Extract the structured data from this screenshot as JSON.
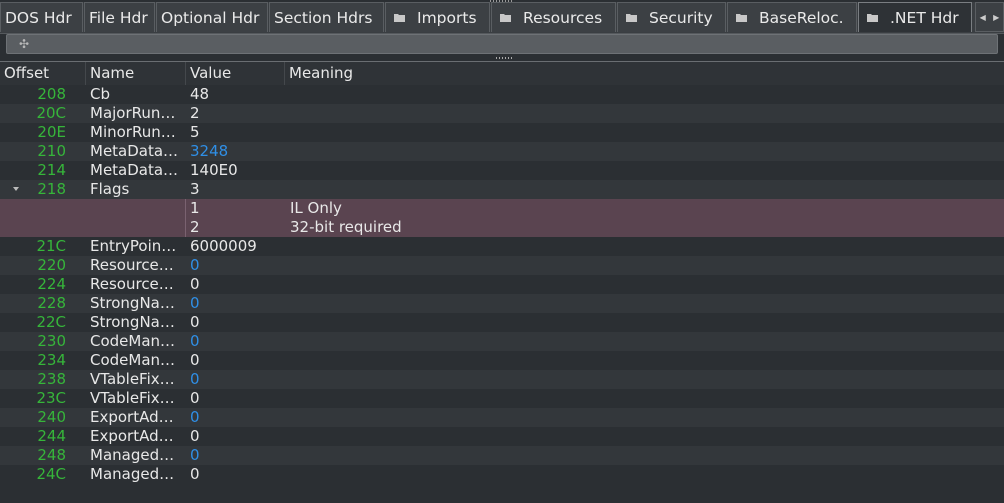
{
  "tabs": [
    {
      "label": "DOS Hdr",
      "folder": false
    },
    {
      "label": "File Hdr",
      "folder": false
    },
    {
      "label": "Optional Hdr",
      "folder": false
    },
    {
      "label": "Section Hdrs",
      "folder": false
    },
    {
      "label": "Imports",
      "folder": true
    },
    {
      "label": "Resources",
      "folder": true
    },
    {
      "label": "Security",
      "folder": true
    },
    {
      "label": "BaseReloc.",
      "folder": true
    },
    {
      "label": ".NET Hdr",
      "folder": true,
      "active": true
    }
  ],
  "columns": {
    "offset": "Offset",
    "name": "Name",
    "value": "Value",
    "meaning": "Meaning"
  },
  "rows": [
    {
      "offset": "208",
      "name": "Cb",
      "value": "48",
      "link": false
    },
    {
      "offset": "20C",
      "name": "MajorRun…",
      "value": "2",
      "link": false
    },
    {
      "offset": "20E",
      "name": "MinorRun…",
      "value": "5",
      "link": false
    },
    {
      "offset": "210",
      "name": "MetaData…",
      "value": "3248",
      "link": true
    },
    {
      "offset": "214",
      "name": "MetaData…",
      "value": "140E0",
      "link": false
    },
    {
      "offset": "218",
      "name": "Flags",
      "value": "3",
      "link": false,
      "expanded": true
    },
    {
      "sub": true,
      "value": "1",
      "meaning": "IL Only"
    },
    {
      "sub": true,
      "value": "2",
      "meaning": "32-bit required"
    },
    {
      "offset": "21C",
      "name": "EntryPoin…",
      "value": "6000009",
      "link": false
    },
    {
      "offset": "220",
      "name": "Resource…",
      "value": "0",
      "link": true
    },
    {
      "offset": "224",
      "name": "Resource…",
      "value": "0",
      "link": false
    },
    {
      "offset": "228",
      "name": "StrongNa…",
      "value": "0",
      "link": true
    },
    {
      "offset": "22C",
      "name": "StrongNa…",
      "value": "0",
      "link": false
    },
    {
      "offset": "230",
      "name": "CodeMan…",
      "value": "0",
      "link": true
    },
    {
      "offset": "234",
      "name": "CodeMan…",
      "value": "0",
      "link": false
    },
    {
      "offset": "238",
      "name": "VTableFix…",
      "value": "0",
      "link": true
    },
    {
      "offset": "23C",
      "name": "VTableFix…",
      "value": "0",
      "link": false
    },
    {
      "offset": "240",
      "name": "ExportAd…",
      "value": "0",
      "link": true
    },
    {
      "offset": "244",
      "name": "ExportAd…",
      "value": "0",
      "link": false
    },
    {
      "offset": "248",
      "name": "Managed…",
      "value": "0",
      "link": true
    },
    {
      "offset": "24C",
      "name": "Managed…",
      "value": "0",
      "link": false
    }
  ],
  "colors": {
    "offset": "#36b53a",
    "link": "#2f8fe6",
    "flag_row": "#5a4450"
  },
  "icons": {
    "folder": "folder-icon",
    "move": "move-icon",
    "tab_left": "arrow-left-icon",
    "tab_right": "arrow-right-icon"
  }
}
